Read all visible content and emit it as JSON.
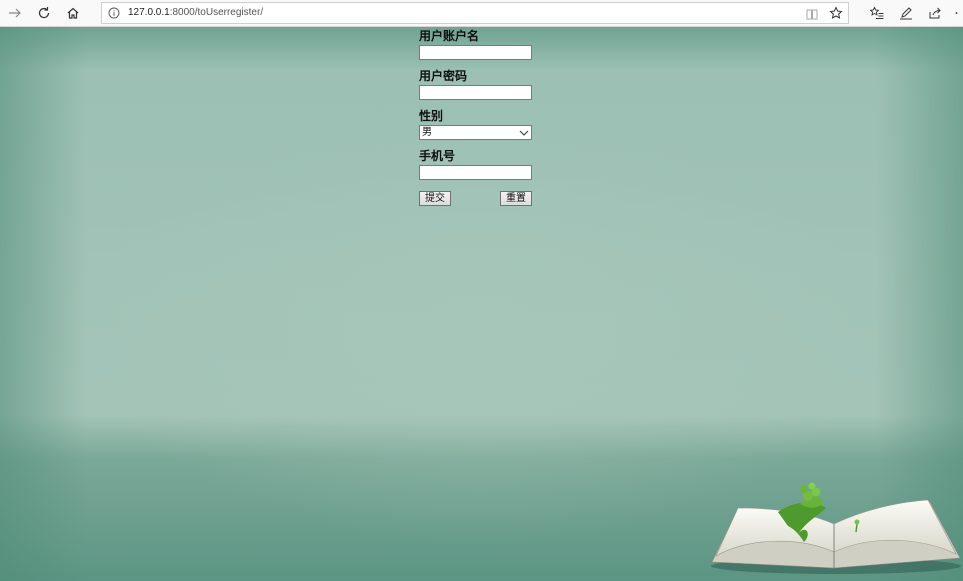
{
  "browser": {
    "url_host": "127.0.0.1",
    "url_rest": ":8000/toUserregister/"
  },
  "form": {
    "username_label": "用户账户名",
    "username_value": "",
    "password_label": "用户密码",
    "password_value": "",
    "gender_label": "性别",
    "gender_selected": "男",
    "phone_label": "手机号",
    "phone_value": "",
    "submit_label": "提交",
    "reset_label": "重置"
  },
  "icons": {
    "forward": "arrow-right-icon",
    "refresh": "refresh-icon",
    "home": "home-icon",
    "info": "info-icon",
    "reading_view": "book-open-icon",
    "favorite": "star-icon",
    "favorites_list": "favorites-list-icon",
    "notes": "pen-icon",
    "share": "share-icon",
    "more": "more-icon"
  }
}
